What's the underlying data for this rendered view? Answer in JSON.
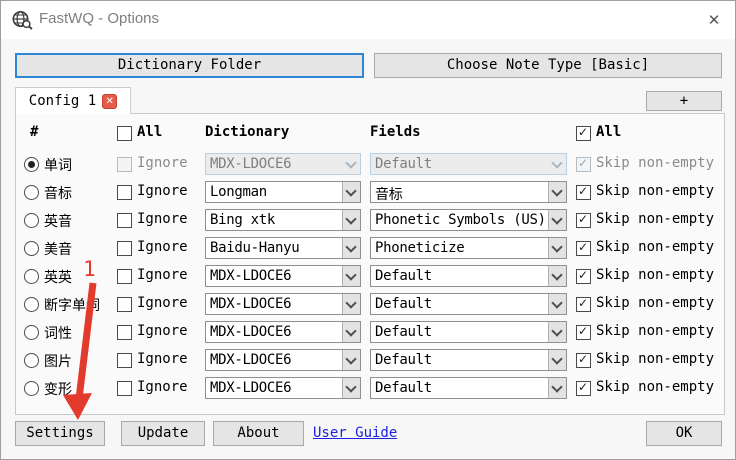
{
  "window": {
    "title": "FastWQ - Options",
    "close_glyph": "✕"
  },
  "top_buttons": {
    "dictionary_folder": "Dictionary Folder",
    "choose_note_type": "Choose Note Type [Basic]"
  },
  "tabs": {
    "config_label": "Config 1",
    "tab_close_glyph": "✕",
    "add_tab_label": "+"
  },
  "table": {
    "headers": {
      "num": "#",
      "all_left": "All",
      "dictionary": "Dictionary",
      "fields": "Fields",
      "all_right": "All"
    },
    "labels": {
      "ignore": "Ignore",
      "skip": "Skip non-empty"
    },
    "header_all_left_checked": false,
    "header_all_right_checked": true,
    "rows": [
      {
        "label": "单词",
        "selected": true,
        "disabled": true,
        "ignore_checked": false,
        "dictionary": "MDX-LDOCE6",
        "field": "Default",
        "skip_checked": true
      },
      {
        "label": "音标",
        "selected": false,
        "disabled": false,
        "ignore_checked": false,
        "dictionary": "Longman",
        "field": "音标",
        "skip_checked": true
      },
      {
        "label": "英音",
        "selected": false,
        "disabled": false,
        "ignore_checked": false,
        "dictionary": "Bing xtk",
        "field": "Phonetic Symbols (US)",
        "skip_checked": true
      },
      {
        "label": "美音",
        "selected": false,
        "disabled": false,
        "ignore_checked": false,
        "dictionary": "Baidu-Hanyu",
        "field": "Phoneticize",
        "skip_checked": true
      },
      {
        "label": "英英",
        "selected": false,
        "disabled": false,
        "ignore_checked": false,
        "dictionary": "MDX-LDOCE6",
        "field": "Default",
        "skip_checked": true
      },
      {
        "label": "断字单词",
        "selected": false,
        "disabled": false,
        "ignore_checked": false,
        "dictionary": "MDX-LDOCE6",
        "field": "Default",
        "skip_checked": true
      },
      {
        "label": "词性",
        "selected": false,
        "disabled": false,
        "ignore_checked": false,
        "dictionary": "MDX-LDOCE6",
        "field": "Default",
        "skip_checked": true
      },
      {
        "label": "图片",
        "selected": false,
        "disabled": false,
        "ignore_checked": false,
        "dictionary": "MDX-LDOCE6",
        "field": "Default",
        "skip_checked": true
      },
      {
        "label": "变形",
        "selected": false,
        "disabled": false,
        "ignore_checked": false,
        "dictionary": "MDX-LDOCE6",
        "field": "Default",
        "skip_checked": true
      }
    ]
  },
  "bottom_buttons": {
    "settings": "Settings",
    "update": "Update",
    "about": "About",
    "user_guide": "User Guide",
    "ok": "OK"
  },
  "annotation": {
    "step_number": "1",
    "color": "#e23b2e"
  }
}
